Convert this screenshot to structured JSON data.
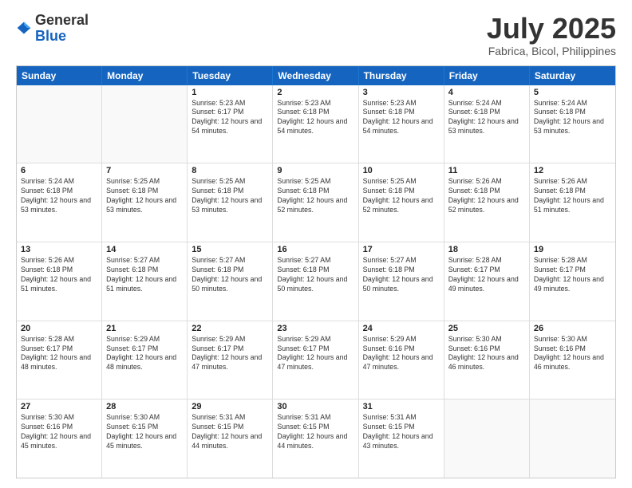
{
  "header": {
    "logo_general": "General",
    "logo_blue": "Blue",
    "month_year": "July 2025",
    "location": "Fabrica, Bicol, Philippines"
  },
  "days_of_week": [
    "Sunday",
    "Monday",
    "Tuesday",
    "Wednesday",
    "Thursday",
    "Friday",
    "Saturday"
  ],
  "weeks": [
    [
      {
        "day": "",
        "empty": true
      },
      {
        "day": "",
        "empty": true
      },
      {
        "day": "1",
        "sunrise": "Sunrise: 5:23 AM",
        "sunset": "Sunset: 6:17 PM",
        "daylight": "Daylight: 12 hours and 54 minutes."
      },
      {
        "day": "2",
        "sunrise": "Sunrise: 5:23 AM",
        "sunset": "Sunset: 6:18 PM",
        "daylight": "Daylight: 12 hours and 54 minutes."
      },
      {
        "day": "3",
        "sunrise": "Sunrise: 5:23 AM",
        "sunset": "Sunset: 6:18 PM",
        "daylight": "Daylight: 12 hours and 54 minutes."
      },
      {
        "day": "4",
        "sunrise": "Sunrise: 5:24 AM",
        "sunset": "Sunset: 6:18 PM",
        "daylight": "Daylight: 12 hours and 53 minutes."
      },
      {
        "day": "5",
        "sunrise": "Sunrise: 5:24 AM",
        "sunset": "Sunset: 6:18 PM",
        "daylight": "Daylight: 12 hours and 53 minutes."
      }
    ],
    [
      {
        "day": "6",
        "sunrise": "Sunrise: 5:24 AM",
        "sunset": "Sunset: 6:18 PM",
        "daylight": "Daylight: 12 hours and 53 minutes."
      },
      {
        "day": "7",
        "sunrise": "Sunrise: 5:25 AM",
        "sunset": "Sunset: 6:18 PM",
        "daylight": "Daylight: 12 hours and 53 minutes."
      },
      {
        "day": "8",
        "sunrise": "Sunrise: 5:25 AM",
        "sunset": "Sunset: 6:18 PM",
        "daylight": "Daylight: 12 hours and 53 minutes."
      },
      {
        "day": "9",
        "sunrise": "Sunrise: 5:25 AM",
        "sunset": "Sunset: 6:18 PM",
        "daylight": "Daylight: 12 hours and 52 minutes."
      },
      {
        "day": "10",
        "sunrise": "Sunrise: 5:25 AM",
        "sunset": "Sunset: 6:18 PM",
        "daylight": "Daylight: 12 hours and 52 minutes."
      },
      {
        "day": "11",
        "sunrise": "Sunrise: 5:26 AM",
        "sunset": "Sunset: 6:18 PM",
        "daylight": "Daylight: 12 hours and 52 minutes."
      },
      {
        "day": "12",
        "sunrise": "Sunrise: 5:26 AM",
        "sunset": "Sunset: 6:18 PM",
        "daylight": "Daylight: 12 hours and 51 minutes."
      }
    ],
    [
      {
        "day": "13",
        "sunrise": "Sunrise: 5:26 AM",
        "sunset": "Sunset: 6:18 PM",
        "daylight": "Daylight: 12 hours and 51 minutes."
      },
      {
        "day": "14",
        "sunrise": "Sunrise: 5:27 AM",
        "sunset": "Sunset: 6:18 PM",
        "daylight": "Daylight: 12 hours and 51 minutes."
      },
      {
        "day": "15",
        "sunrise": "Sunrise: 5:27 AM",
        "sunset": "Sunset: 6:18 PM",
        "daylight": "Daylight: 12 hours and 50 minutes."
      },
      {
        "day": "16",
        "sunrise": "Sunrise: 5:27 AM",
        "sunset": "Sunset: 6:18 PM",
        "daylight": "Daylight: 12 hours and 50 minutes."
      },
      {
        "day": "17",
        "sunrise": "Sunrise: 5:27 AM",
        "sunset": "Sunset: 6:18 PM",
        "daylight": "Daylight: 12 hours and 50 minutes."
      },
      {
        "day": "18",
        "sunrise": "Sunrise: 5:28 AM",
        "sunset": "Sunset: 6:17 PM",
        "daylight": "Daylight: 12 hours and 49 minutes."
      },
      {
        "day": "19",
        "sunrise": "Sunrise: 5:28 AM",
        "sunset": "Sunset: 6:17 PM",
        "daylight": "Daylight: 12 hours and 49 minutes."
      }
    ],
    [
      {
        "day": "20",
        "sunrise": "Sunrise: 5:28 AM",
        "sunset": "Sunset: 6:17 PM",
        "daylight": "Daylight: 12 hours and 48 minutes."
      },
      {
        "day": "21",
        "sunrise": "Sunrise: 5:29 AM",
        "sunset": "Sunset: 6:17 PM",
        "daylight": "Daylight: 12 hours and 48 minutes."
      },
      {
        "day": "22",
        "sunrise": "Sunrise: 5:29 AM",
        "sunset": "Sunset: 6:17 PM",
        "daylight": "Daylight: 12 hours and 47 minutes."
      },
      {
        "day": "23",
        "sunrise": "Sunrise: 5:29 AM",
        "sunset": "Sunset: 6:17 PM",
        "daylight": "Daylight: 12 hours and 47 minutes."
      },
      {
        "day": "24",
        "sunrise": "Sunrise: 5:29 AM",
        "sunset": "Sunset: 6:16 PM",
        "daylight": "Daylight: 12 hours and 47 minutes."
      },
      {
        "day": "25",
        "sunrise": "Sunrise: 5:30 AM",
        "sunset": "Sunset: 6:16 PM",
        "daylight": "Daylight: 12 hours and 46 minutes."
      },
      {
        "day": "26",
        "sunrise": "Sunrise: 5:30 AM",
        "sunset": "Sunset: 6:16 PM",
        "daylight": "Daylight: 12 hours and 46 minutes."
      }
    ],
    [
      {
        "day": "27",
        "sunrise": "Sunrise: 5:30 AM",
        "sunset": "Sunset: 6:16 PM",
        "daylight": "Daylight: 12 hours and 45 minutes."
      },
      {
        "day": "28",
        "sunrise": "Sunrise: 5:30 AM",
        "sunset": "Sunset: 6:15 PM",
        "daylight": "Daylight: 12 hours and 45 minutes."
      },
      {
        "day": "29",
        "sunrise": "Sunrise: 5:31 AM",
        "sunset": "Sunset: 6:15 PM",
        "daylight": "Daylight: 12 hours and 44 minutes."
      },
      {
        "day": "30",
        "sunrise": "Sunrise: 5:31 AM",
        "sunset": "Sunset: 6:15 PM",
        "daylight": "Daylight: 12 hours and 44 minutes."
      },
      {
        "day": "31",
        "sunrise": "Sunrise: 5:31 AM",
        "sunset": "Sunset: 6:15 PM",
        "daylight": "Daylight: 12 hours and 43 minutes."
      },
      {
        "day": "",
        "empty": true
      },
      {
        "day": "",
        "empty": true
      }
    ]
  ]
}
